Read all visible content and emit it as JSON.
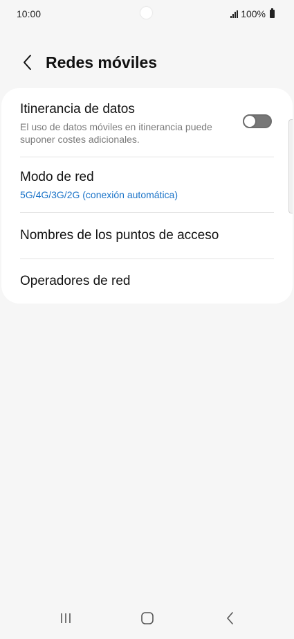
{
  "status_bar": {
    "time": "10:00",
    "battery": "100%",
    "signal_icon": "signal-icon",
    "battery_icon": "battery-icon"
  },
  "header": {
    "title": "Redes móviles",
    "back_icon": "chevron-left-icon"
  },
  "settings": {
    "roaming": {
      "title": "Itinerancia de datos",
      "subtitle": "El uso de datos móviles en itinerancia puede suponer costes adicionales.",
      "toggle_on": false
    },
    "network_mode": {
      "title": "Modo de red",
      "value": "5G/4G/3G/2G (conexión automática)"
    },
    "apn": {
      "title": "Nombres de los puntos de acceso"
    },
    "operators": {
      "title": "Operadores de red"
    }
  },
  "colors": {
    "background": "#f6f6f6",
    "card": "#ffffff",
    "accent_blue": "#1a73c8",
    "subtitle_gray": "#7a7a7a"
  },
  "nav_bar": {
    "recents_icon": "recents-icon",
    "home_icon": "home-icon",
    "back_icon": "back-icon"
  }
}
